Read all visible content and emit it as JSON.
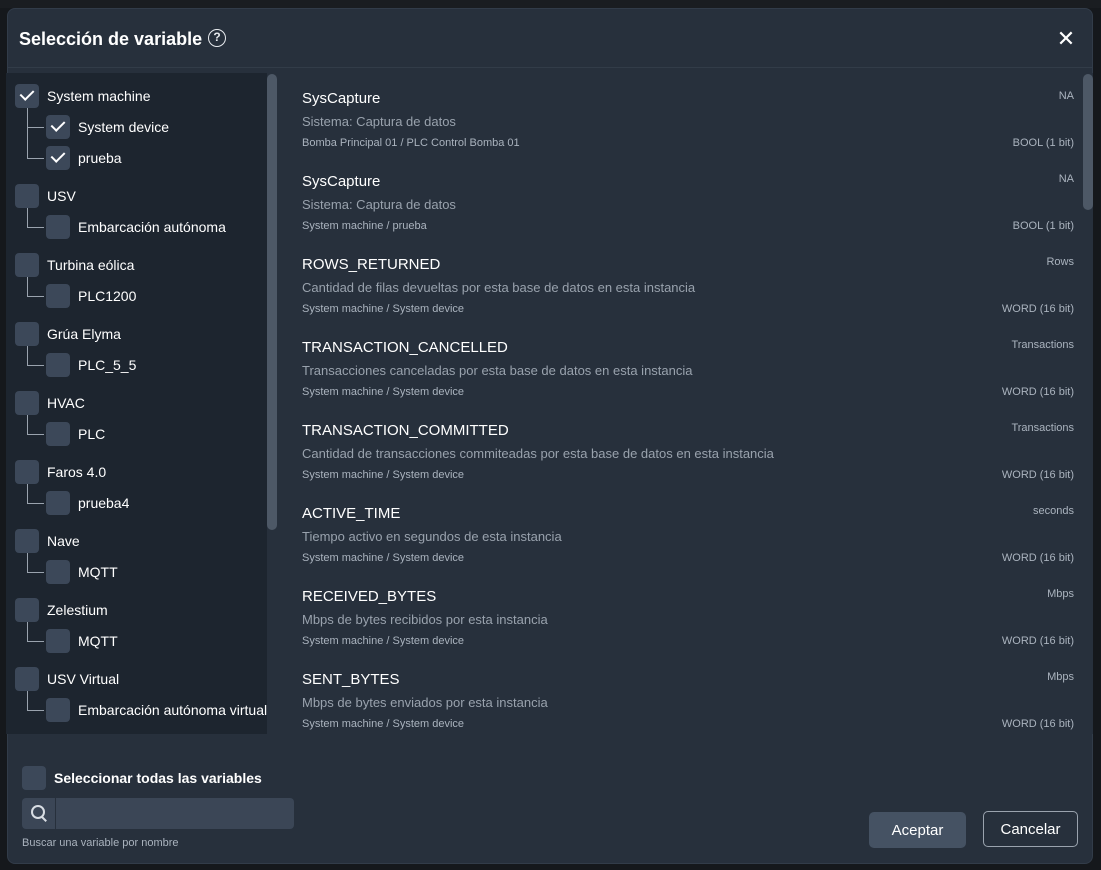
{
  "dialog": {
    "title": "Selección de variable",
    "help_icon": "?",
    "close_icon": "✕"
  },
  "tree": [
    {
      "label": "System machine",
      "checked": true,
      "children": [
        {
          "label": "System device",
          "checked": true
        },
        {
          "label": "prueba",
          "checked": true
        }
      ]
    },
    {
      "label": "USV",
      "checked": false,
      "children": [
        {
          "label": "Embarcación autónoma",
          "checked": false
        }
      ]
    },
    {
      "label": "Turbina eólica",
      "checked": false,
      "children": [
        {
          "label": "PLC1200",
          "checked": false
        }
      ]
    },
    {
      "label": "Grúa Elyma",
      "checked": false,
      "children": [
        {
          "label": "PLC_5_5",
          "checked": false
        }
      ]
    },
    {
      "label": "HVAC",
      "checked": false,
      "children": [
        {
          "label": "PLC",
          "checked": false
        }
      ]
    },
    {
      "label": "Faros 4.0",
      "checked": false,
      "children": [
        {
          "label": "prueba4",
          "checked": false
        }
      ]
    },
    {
      "label": "Nave",
      "checked": false,
      "children": [
        {
          "label": "MQTT",
          "checked": false
        }
      ]
    },
    {
      "label": "Zelestium",
      "checked": false,
      "children": [
        {
          "label": "MQTT",
          "checked": false
        }
      ]
    },
    {
      "label": "USV Virtual",
      "checked": false,
      "children": [
        {
          "label": "Embarcación autónoma virtual",
          "checked": false
        }
      ]
    }
  ],
  "variables": [
    {
      "name": "SysCapture",
      "unit": "NA",
      "description": "Sistema: Captura de datos",
      "path": "Bomba Principal 01 / PLC Control Bomba 01",
      "type": "BOOL (1 bit)"
    },
    {
      "name": "SysCapture",
      "unit": "NA",
      "description": "Sistema: Captura de datos",
      "path": "System machine / prueba",
      "type": "BOOL (1 bit)"
    },
    {
      "name": "ROWS_RETURNED",
      "unit": "Rows",
      "description": "Cantidad de filas devueltas por esta base de datos en esta instancia",
      "path": "System machine / System device",
      "type": "WORD (16 bit)"
    },
    {
      "name": "TRANSACTION_CANCELLED",
      "unit": "Transactions",
      "description": "Transacciones canceladas por esta base de datos en esta instancia",
      "path": "System machine / System device",
      "type": "WORD (16 bit)"
    },
    {
      "name": "TRANSACTION_COMMITTED",
      "unit": "Transactions",
      "description": "Cantidad de transacciones commiteadas por esta base de datos en esta instancia",
      "path": "System machine / System device",
      "type": "WORD (16 bit)"
    },
    {
      "name": "ACTIVE_TIME",
      "unit": "seconds",
      "description": "Tiempo activo en segundos de esta instancia",
      "path": "System machine / System device",
      "type": "WORD (16 bit)"
    },
    {
      "name": "RECEIVED_BYTES",
      "unit": "Mbps",
      "description": "Mbps de bytes recibidos por esta instancia",
      "path": "System machine / System device",
      "type": "WORD (16 bit)"
    },
    {
      "name": "SENT_BYTES",
      "unit": "Mbps",
      "description": "Mbps de bytes enviados por esta instancia",
      "path": "System machine / System device",
      "type": "WORD (16 bit)"
    }
  ],
  "footer": {
    "select_all_label": "Seleccionar todas las variables",
    "select_all_checked": false,
    "search_value": "",
    "search_placeholder": "",
    "search_helper": "Buscar una variable por nombre",
    "accept_label": "Aceptar",
    "cancel_label": "Cancelar"
  },
  "icons": {
    "help": "help-circle-icon",
    "close": "close-icon",
    "search": "search-icon",
    "check": "check-icon"
  },
  "colors": {
    "dialog_bg": "#27303c",
    "tree_bg": "#1d252f",
    "checkbox_bg": "#3c4859",
    "accept_bg": "#455263"
  }
}
